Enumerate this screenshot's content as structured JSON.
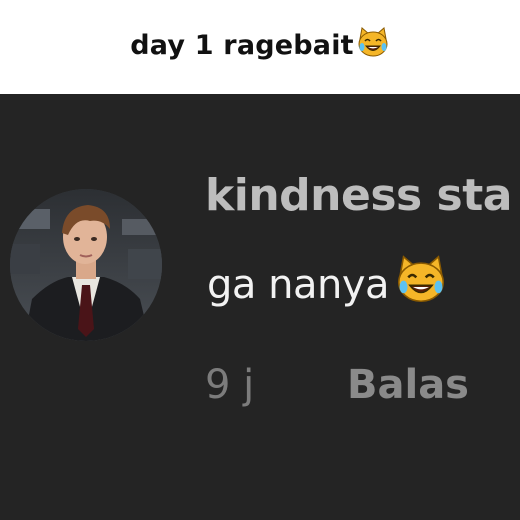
{
  "header": {
    "title": "day 1 ragebait",
    "emoji": "joy-cat-icon"
  },
  "comment": {
    "username": "kindness sta",
    "text": "ga nanya",
    "emoji": "joy-cat-icon",
    "time": "9 j",
    "reply_label": "Balas"
  },
  "colors": {
    "background": "#242424",
    "username": "#bdbdbd",
    "comment_text": "#f2f2f2",
    "meta": "#7c7c7c",
    "emoji_face": "#f5b628"
  }
}
